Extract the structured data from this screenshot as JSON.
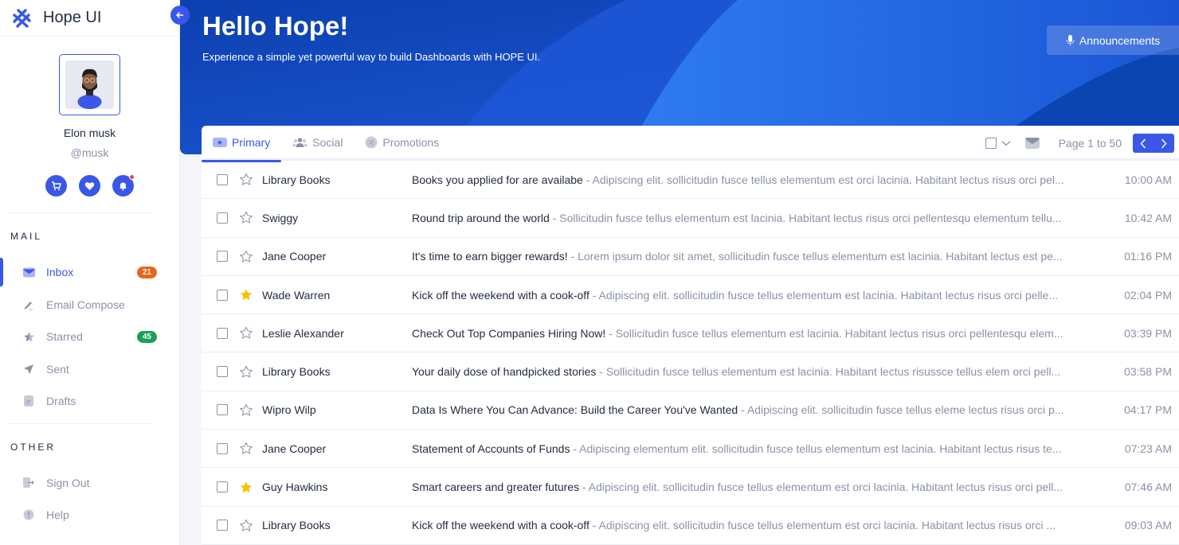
{
  "app": {
    "name": "Hope UI"
  },
  "colors": {
    "primary": "#3a57e8",
    "orange_badge": "#e9651e",
    "green_badge": "#1aa053",
    "star_filled": "#f6c300"
  },
  "profile": {
    "name": "Elon musk",
    "handle": "@musk"
  },
  "sidebar": {
    "sections": [
      {
        "label": "MAIL"
      },
      {
        "label": "OTHER"
      }
    ],
    "mail_items": [
      {
        "label": "Inbox",
        "icon": "inbox-icon",
        "badge": "21",
        "active": true
      },
      {
        "label": "Email Compose",
        "icon": "pencil-icon"
      },
      {
        "label": "Starred",
        "icon": "star-icon",
        "badge": "45"
      },
      {
        "label": "Sent",
        "icon": "send-icon"
      },
      {
        "label": "Drafts",
        "icon": "document-icon"
      }
    ],
    "other_items": [
      {
        "label": "Sign Out",
        "icon": "sign-out-icon"
      },
      {
        "label": "Help",
        "icon": "help-icon"
      }
    ]
  },
  "header": {
    "title": "Hello Hope!",
    "subtitle": "Experience a simple yet powerful way to build Dashboards with HOPE UI.",
    "announcements_label": "Announcements"
  },
  "tabs": [
    {
      "label": "Primary",
      "active": true
    },
    {
      "label": "Social"
    },
    {
      "label": "Promotions"
    }
  ],
  "toolbar": {
    "page_info": "Page 1 to 50"
  },
  "emails": [
    {
      "sender": "Library Books",
      "starred": false,
      "subject": "Books you applied for are availabe",
      "preview": "Adipiscing elit. sollicitudin fusce tellus elementum est orci lacinia. Habitant lectus risus orci pel...",
      "time": "10:00 AM"
    },
    {
      "sender": "Swiggy",
      "starred": false,
      "subject": "Round trip around the world",
      "preview": "Sollicitudin fusce tellus elementum est lacinia. Habitant lectus risus orci pellentesqu elementum tellu...",
      "time": "10:42 AM"
    },
    {
      "sender": "Jane Cooper",
      "starred": false,
      "subject": "It's time to earn bigger rewards!",
      "preview": "Lorem ipsum dolor sit amet, sollicitudin fusce tellus elementum est lacinia. Habitant lectus est pe...",
      "time": "01:16 PM"
    },
    {
      "sender": "Wade Warren",
      "starred": true,
      "subject": "Kick off the weekend with a cook-off",
      "preview": "Adipiscing elit. sollicitudin fusce tellus elementum est lacinia. Habitant lectus risus orci pelle...",
      "time": "02:04 PM"
    },
    {
      "sender": "Leslie Alexander",
      "starred": false,
      "subject": "Check Out Top Companies Hiring Now!",
      "preview": "Sollicitudin fusce tellus elementum est lacinia. Habitant lectus risus orci pellentesqu elem...",
      "time": "03:39 PM"
    },
    {
      "sender": "Library Books",
      "starred": false,
      "subject": "Your daily dose of handpicked stories",
      "preview": "Sollicitudin fusce tellus elementum est lacinia. Habitant lectus risussce tellus elem orci pell...",
      "time": "03:58 PM"
    },
    {
      "sender": "Wipro Wilp",
      "starred": false,
      "subject": "Data Is Where You Can Advance: Build the Career You've Wanted",
      "preview": "Adipiscing elit. sollicitudin fusce tellus eleme lectus risus orci p...",
      "time": "04:17 PM"
    },
    {
      "sender": "Jane Cooper",
      "starred": false,
      "subject": "Statement of Accounts of Funds",
      "preview": "Adipiscing elementum elit. sollicitudin fusce tellus elementum est lacinia. Habitant lectus risus te...",
      "time": "07:23 AM"
    },
    {
      "sender": "Guy Hawkins",
      "starred": true,
      "subject": "Smart careers and greater futures",
      "preview": "Adipiscing elit. sollicitudin fusce tellus elementum est orci lacinia. Habitant lectus risus orci pell...",
      "time": "07:46 AM"
    },
    {
      "sender": "Library Books",
      "starred": false,
      "subject": "Kick off the weekend with a cook-off",
      "preview": "Adipiscing elit. sollicitudin fusce tellus elementum est orci lacinia. Habitant lectus risus orci ...",
      "time": "09:03 AM"
    }
  ]
}
